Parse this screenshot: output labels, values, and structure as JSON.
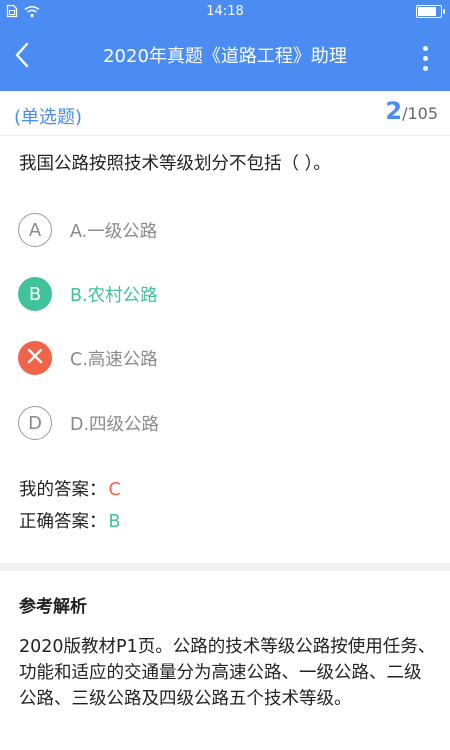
{
  "status_bar": {
    "time": "14:18"
  },
  "header": {
    "title": "2020年真题《道路工程》助理"
  },
  "question_meta": {
    "type": "(单选题)",
    "current": "2",
    "total": "/105"
  },
  "question": {
    "text": "我国公路按照技术等级划分不包括（ ）。"
  },
  "options": [
    {
      "letter": "A",
      "text": "A.一级公路",
      "state": "normal"
    },
    {
      "letter": "B",
      "text": "B.农村公路",
      "state": "correct"
    },
    {
      "letter": "",
      "text": "C.高速公路",
      "state": "wrong"
    },
    {
      "letter": "D",
      "text": "D.四级公路",
      "state": "normal"
    }
  ],
  "answers": {
    "my_label": "我的答案：",
    "my_value": "C",
    "correct_label": "正确答案：",
    "correct_value": "B"
  },
  "analysis": {
    "title": "参考解析",
    "text": "2020版教材P1页。公路的技术等级公路按使用任务、功能和适应的交通量分为高速公路、一级公路、二级公路、三级公路及四级公路五个技术等级。"
  },
  "colors": {
    "header_bg": "#4a8cf2",
    "accent": "#4a8cf2",
    "correct": "#40c29a",
    "wrong": "#f0644a"
  },
  "icons": {
    "back": "back-arrow-icon",
    "more": "more-vertical-icon",
    "wrong": "close-icon",
    "status": [
      "sim-icon",
      "wifi-icon",
      "battery-icon"
    ]
  }
}
